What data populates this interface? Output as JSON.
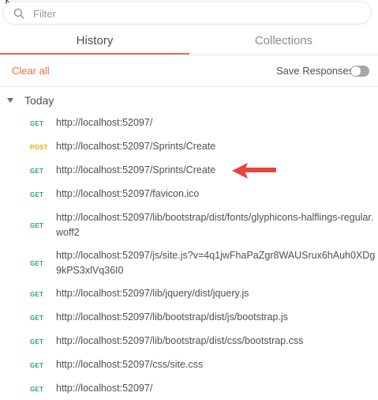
{
  "filter": {
    "placeholder": "Filter",
    "value": ""
  },
  "tabs": [
    {
      "label": "History",
      "active": true
    },
    {
      "label": "Collections",
      "active": false
    }
  ],
  "toolbar": {
    "clear_all_label": "Clear all",
    "save_responses_label": "Save Responses",
    "save_responses_enabled": false
  },
  "group": {
    "label": "Today",
    "expanded": true
  },
  "entries": [
    {
      "method": "GET",
      "url": "http://localhost:52097/"
    },
    {
      "method": "POST",
      "url": "http://localhost:52097/Sprints/Create"
    },
    {
      "method": "GET",
      "url": "http://localhost:52097/Sprints/Create"
    },
    {
      "method": "GET",
      "url": "http://localhost:52097/favicon.ico"
    },
    {
      "method": "GET",
      "url": "http://localhost:52097/lib/bootstrap/dist/fonts/glyphicons-halflings-regular.woff2"
    },
    {
      "method": "GET",
      "url": "http://localhost:52097/js/site.js?v=4q1jwFhaPaZgr8WAUSrux6hAuh0XDg9kPS3xlVq36I0"
    },
    {
      "method": "GET",
      "url": "http://localhost:52097/lib/jquery/dist/jquery.js"
    },
    {
      "method": "GET",
      "url": "http://localhost:52097/lib/bootstrap/dist/js/bootstrap.js"
    },
    {
      "method": "GET",
      "url": "http://localhost:52097/lib/bootstrap/dist/css/bootstrap.css"
    },
    {
      "method": "GET",
      "url": "http://localhost:52097/css/site.css"
    },
    {
      "method": "GET",
      "url": "http://localhost:52097/"
    }
  ],
  "colors": {
    "accent": "#f26b3a",
    "get": "#2aa46b",
    "post": "#f2a600",
    "annotation_arrow": "#e8443a"
  },
  "icons": {
    "filter": "search-icon",
    "group_toggle": "caret-down-icon",
    "pointer": "mouse-cursor-icon",
    "annotation": "red-arrow-icon"
  }
}
